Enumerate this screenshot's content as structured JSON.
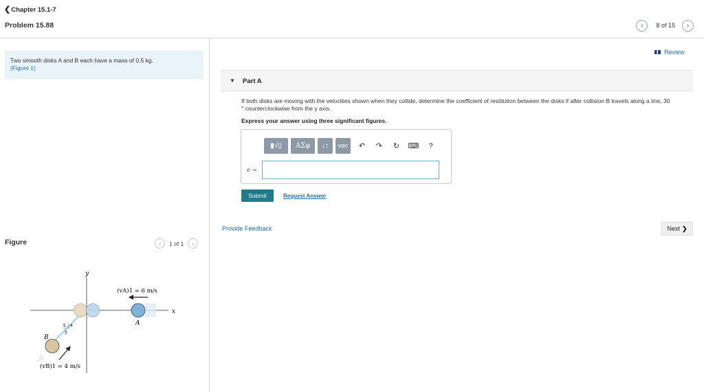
{
  "header": {
    "chapter": "Chapter 15.1-7",
    "problem": "Problem 15.88",
    "pager_text": "8 of 15"
  },
  "left": {
    "problem_text": "Two smooth disks A and B each have a mass of 0.5 kg.",
    "figure_link": "(Figure 1)",
    "figure_label": "Figure",
    "figure_pager": "1 of 1"
  },
  "figure": {
    "y_axis": "y",
    "x_axis": "x",
    "va_label": "(vA)1 = 6 m/s",
    "vb_label": "(vB)1 = 4 m/s",
    "disk_a": "A",
    "disk_b": "B",
    "slope_5": "5",
    "slope_4": "4",
    "slope_3": "3"
  },
  "review": "Review",
  "part": {
    "title": "Part A",
    "question_line1": "If both disks are moving with the velocities shown when they collide, determine the coefficient of restitution between the disks if after collision B travels along a line, 30",
    "question_line2": "° counterclockwise from the y axis.",
    "instruction": "Express your answer using three significant figures."
  },
  "toolbar": {
    "templates": "▮√▯",
    "greek": "ΑΣφ",
    "arrows": "↓↑",
    "vec": "vec",
    "help": "?"
  },
  "answer": {
    "label": "e =",
    "value": ""
  },
  "buttons": {
    "submit": "Submit",
    "request_answer": "Request Answer",
    "provide_feedback": "Provide Feedback",
    "next": "Next"
  },
  "colors": {
    "accent": "#1d7b8a",
    "link": "#1e6ea8",
    "disk_a": "#7fb2d8",
    "disk_b": "#d9c6a0"
  }
}
